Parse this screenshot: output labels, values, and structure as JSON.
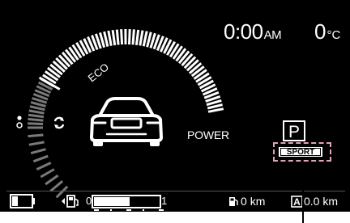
{
  "clock": {
    "time": "0:00",
    "ampm": "AM"
  },
  "temperature": {
    "value": "0",
    "unit": "°C"
  },
  "gauge": {
    "eco_label": "ECO",
    "power_label": "POWER"
  },
  "shift": {
    "position": "P",
    "drive_mode": "SPORT"
  },
  "fuel": {
    "min_label": "0",
    "max_label": "1",
    "level_fraction": 0.55
  },
  "range": {
    "value": "0",
    "unit": "km"
  },
  "trip": {
    "value": "0.0",
    "unit": "km"
  },
  "icons": [
    "car-front-icon",
    "regen-indicator-icon",
    "battery-icon",
    "fuel-pump-icon",
    "range-fuel-icon",
    "trip-a-icon"
  ],
  "colors": {
    "screen": "#000000",
    "gauge_bright": "#ffffff",
    "gauge_dim": "#7a7a7a",
    "callout_dash": "#e2a2bb"
  }
}
